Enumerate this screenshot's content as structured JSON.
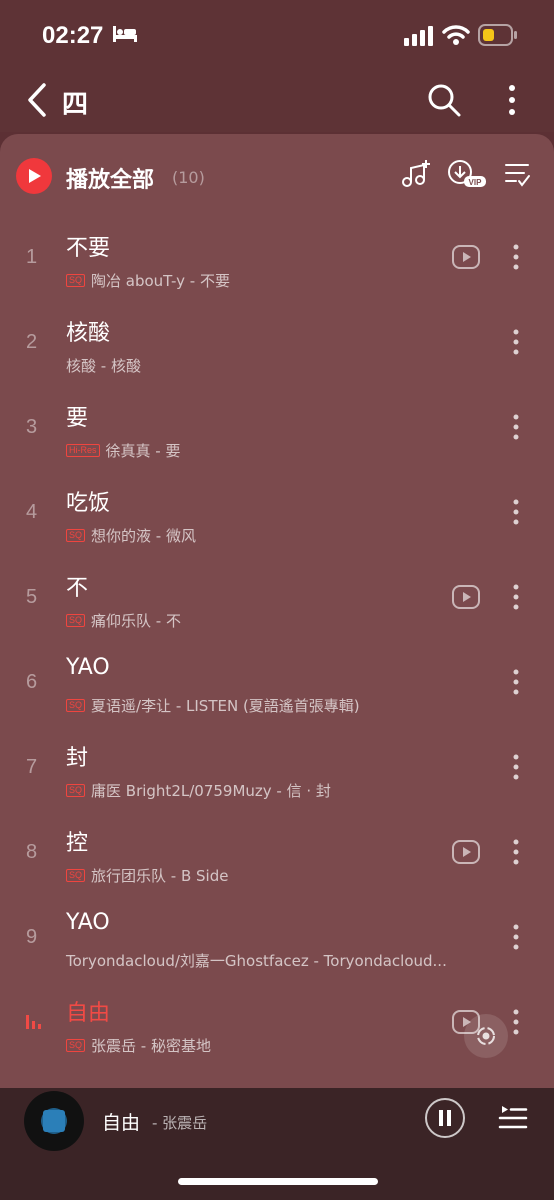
{
  "status_bar": {
    "time": "02:27"
  },
  "nav": {
    "title": "四"
  },
  "play_all": {
    "label": "播放全部",
    "count": "(10)"
  },
  "songs": [
    {
      "index": "1",
      "title": "不要",
      "badge": "SQ",
      "subtitle": "陶冶 abouT-y - 不要",
      "has_mv": true
    },
    {
      "index": "2",
      "title": "核酸",
      "badge": "",
      "subtitle": "核酸 - 核酸",
      "has_mv": false
    },
    {
      "index": "3",
      "title": "要",
      "badge": "Hi-Res",
      "subtitle": "徐真真 - 要",
      "has_mv": false
    },
    {
      "index": "4",
      "title": "吃饭",
      "badge": "SQ",
      "subtitle": "想你的液 - 微风",
      "has_mv": false
    },
    {
      "index": "5",
      "title": "不",
      "badge": "SQ",
      "subtitle": "痛仰乐队 - 不",
      "has_mv": true
    },
    {
      "index": "6",
      "title": "YAO",
      "badge": "SQ",
      "subtitle": "夏语遥/李让 - LISTEN (夏語遙首張專輯)",
      "has_mv": false
    },
    {
      "index": "7",
      "title": "封",
      "badge": "SQ",
      "subtitle": "庸医 Bright2L/0759Muzy - 信 · 封",
      "has_mv": false
    },
    {
      "index": "8",
      "title": "控",
      "badge": "SQ",
      "subtitle": "旅行团乐队 - B Side",
      "has_mv": true
    },
    {
      "index": "9",
      "title": "YAO",
      "badge": "",
      "subtitle": "Toryondacloud/刘嘉一Ghostfacez - Toryondacloud...",
      "has_mv": false
    },
    {
      "index": "",
      "title": "自由",
      "badge": "SQ",
      "subtitle": "张震岳 - 秘密基地",
      "has_mv": true,
      "playing": true
    }
  ],
  "mini_player": {
    "title": "自由",
    "artist": "- 张震岳"
  },
  "colors": {
    "accent": "#f0383c",
    "panel": "#7b4a4d",
    "header": "#5e3336",
    "player": "#3b2426"
  }
}
